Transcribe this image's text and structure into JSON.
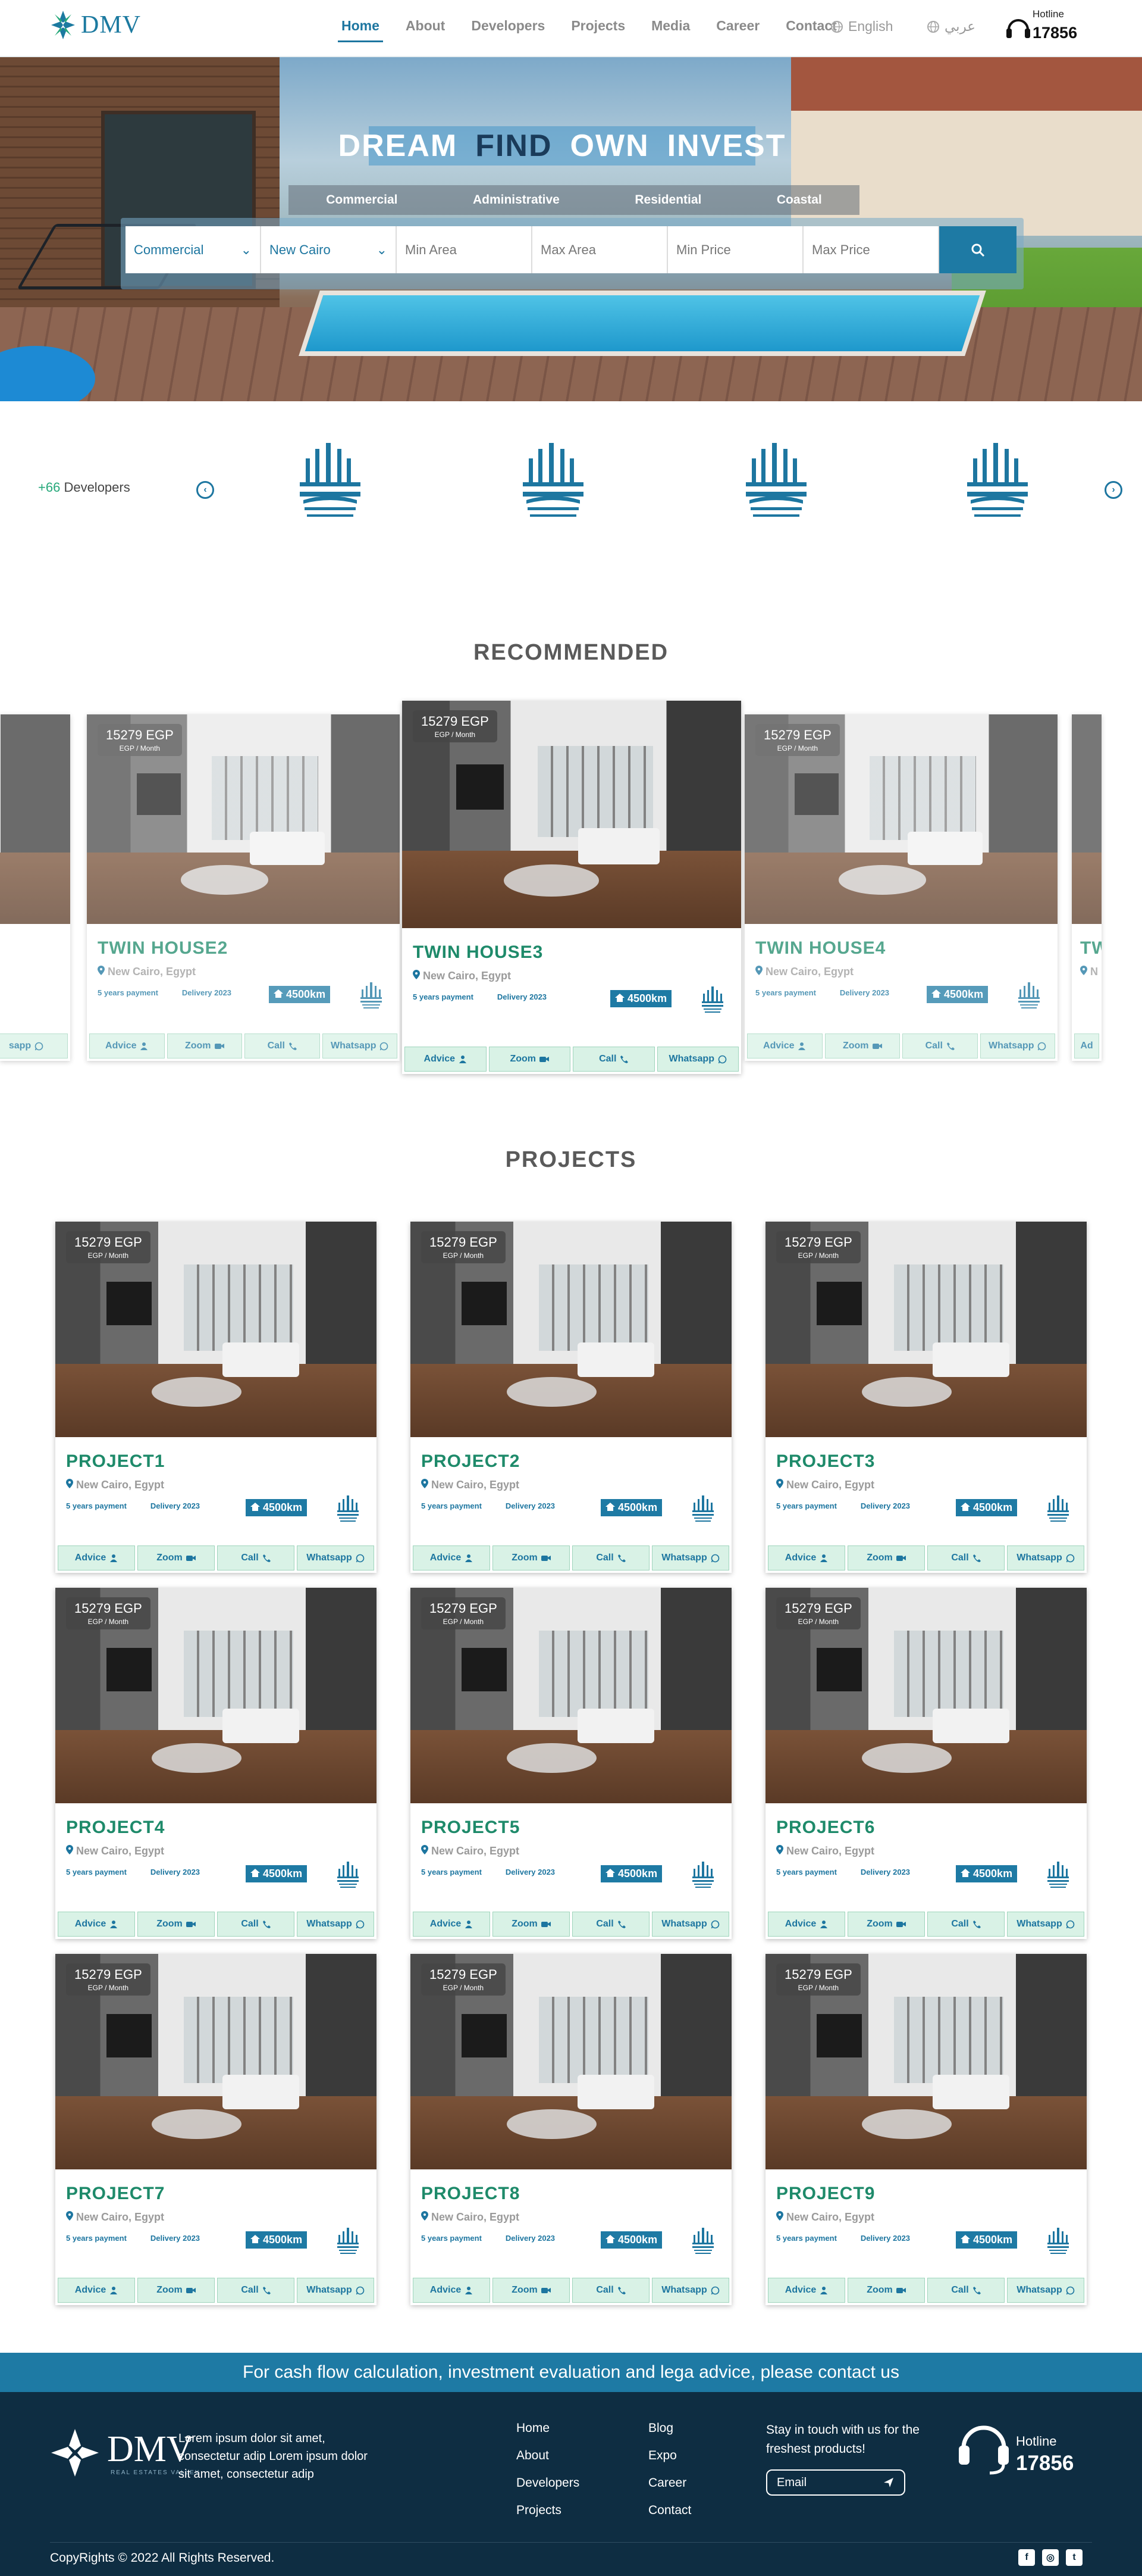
{
  "brand": {
    "name": "DMV",
    "tagline": "REAL ESTATES VALLEY"
  },
  "nav": {
    "items": [
      "Home",
      "About",
      "Developers",
      "Projects",
      "Media",
      "Career",
      "Contact"
    ],
    "active": "Home",
    "lang_en": "English",
    "lang_ar": "عربي",
    "hotline_label": "Hotline",
    "hotline_number": "17856"
  },
  "hero": {
    "headline": [
      "DREAM",
      "FIND",
      "OWN",
      "INVEST"
    ],
    "categories": [
      "Commercial",
      "Administrative",
      "Residential",
      "Coastal"
    ],
    "search": {
      "type": "Commercial",
      "location": "New Cairo",
      "min_area": "Min Area",
      "max_area": "Max Area",
      "min_price": "Min Price",
      "max_price": "Max Price"
    }
  },
  "developers": {
    "count": "+66",
    "label": "Developers"
  },
  "recommended": {
    "title": "RECOMMENDED",
    "cards": [
      {
        "title": "TWIN HOUSE2",
        "price": "15279 EGP",
        "unit": "EGP / Month",
        "location": "New Cairo, Egypt",
        "payment": "5 years payment",
        "delivery": "Delivery 2023",
        "distance": "4500km"
      },
      {
        "title": "TWIN HOUSE3",
        "price": "15279 EGP",
        "unit": "EGP / Month",
        "location": "New Cairo, Egypt",
        "payment": "5 years payment",
        "delivery": "Delivery 2023",
        "distance": "4500km"
      },
      {
        "title": "TWIN HOUSE4",
        "price": "15279 EGP",
        "unit": "EGP / Month",
        "location": "New Cairo, Egypt",
        "payment": "5 years payment",
        "delivery": "Delivery 2023",
        "distance": "4500km"
      }
    ],
    "peek_left_action": "sapp",
    "peek_right_title": "TW",
    "peek_right_loc": "N",
    "peek_right_action": "Ad"
  },
  "actions": {
    "advice": "Advice",
    "zoom": "Zoom",
    "call": "Call",
    "whatsapp": "Whatsapp"
  },
  "projects": {
    "title": "PROJECTS",
    "items": [
      {
        "title": "PROJECT1",
        "price": "15279 EGP",
        "unit": "EGP / Month",
        "location": "New Cairo, Egypt",
        "payment": "5 years payment",
        "delivery": "Delivery 2023",
        "distance": "4500km"
      },
      {
        "title": "PROJECT2",
        "price": "15279 EGP",
        "unit": "EGP / Month",
        "location": "New Cairo, Egypt",
        "payment": "5 years payment",
        "delivery": "Delivery 2023",
        "distance": "4500km"
      },
      {
        "title": "PROJECT3",
        "price": "15279 EGP",
        "unit": "EGP / Month",
        "location": "New Cairo, Egypt",
        "payment": "5 years payment",
        "delivery": "Delivery 2023",
        "distance": "4500km"
      },
      {
        "title": "PROJECT4",
        "price": "15279 EGP",
        "unit": "EGP / Month",
        "location": "New Cairo, Egypt",
        "payment": "5 years payment",
        "delivery": "Delivery 2023",
        "distance": "4500km"
      },
      {
        "title": "PROJECT5",
        "price": "15279 EGP",
        "unit": "EGP / Month",
        "location": "New Cairo, Egypt",
        "payment": "5 years payment",
        "delivery": "Delivery 2023",
        "distance": "4500km"
      },
      {
        "title": "PROJECT6",
        "price": "15279 EGP",
        "unit": "EGP / Month",
        "location": "New Cairo, Egypt",
        "payment": "5 years payment",
        "delivery": "Delivery 2023",
        "distance": "4500km"
      },
      {
        "title": "PROJECT7",
        "price": "15279 EGP",
        "unit": "EGP / Month",
        "location": "New Cairo, Egypt",
        "payment": "5 years payment",
        "delivery": "Delivery 2023",
        "distance": "4500km"
      },
      {
        "title": "PROJECT8",
        "price": "15279 EGP",
        "unit": "EGP / Month",
        "location": "New Cairo, Egypt",
        "payment": "5 years payment",
        "delivery": "Delivery 2023",
        "distance": "4500km"
      },
      {
        "title": "PROJECT9",
        "price": "15279 EGP",
        "unit": "EGP / Month",
        "location": "New Cairo, Egypt",
        "payment": "5 years payment",
        "delivery": "Delivery 2023",
        "distance": "4500km"
      }
    ]
  },
  "footer": {
    "cta": "For cash flow calculation, investment evaluation and lega advice, please contact us",
    "description": "Lorem ipsum dolor sit amet, consectetur adip Lorem ipsum dolor sit amet, consectetur adip",
    "links_col1": [
      "Home",
      "About",
      "Developers",
      "Projects"
    ],
    "links_col2": [
      "Blog",
      "Expo",
      "Career",
      "Contact"
    ],
    "stay": "Stay in touch with us for the freshest products!",
    "email_placeholder": "Email",
    "hotline_label": "Hotline",
    "hotline_number": "17856",
    "copyright": "CopyRights © 2022 All Rights Reserved.",
    "socials": [
      "facebook-icon",
      "instagram-icon",
      "twitter-icon"
    ]
  },
  "colors": {
    "primary": "#1e7aa4",
    "accent_green": "#1e8a6a",
    "footer_bg": "#0e2d42"
  }
}
